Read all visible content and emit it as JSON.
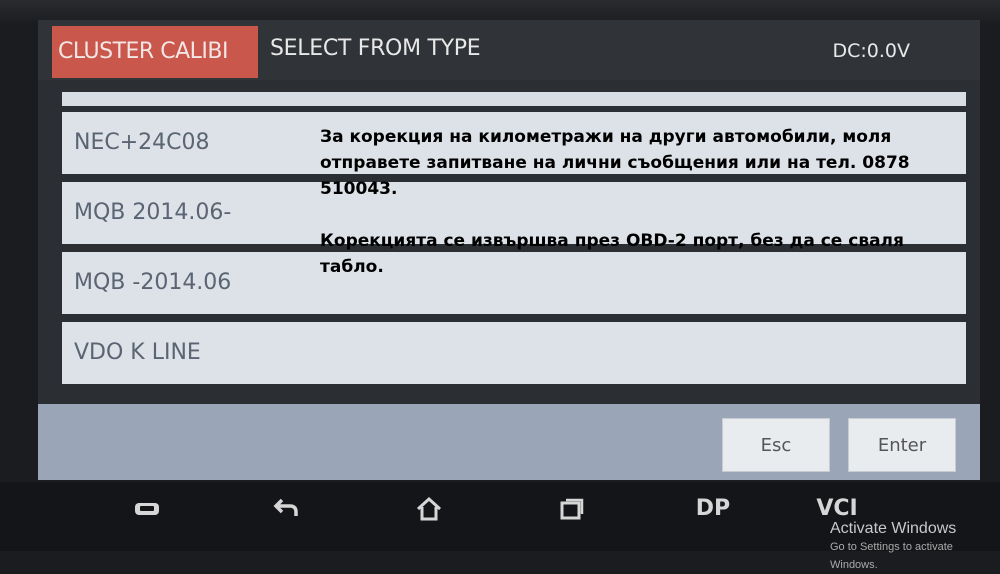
{
  "header": {
    "tab_label": "CLUSTER CALIBI",
    "title": "SELECT FROM TYPE",
    "voltage": "DC:0.0V"
  },
  "list": {
    "items": [
      {
        "label": "NEC+24C08"
      },
      {
        "label": "MQB 2014.06-"
      },
      {
        "label": "MQB -2014.06"
      },
      {
        "label": "VDO K LINE"
      }
    ]
  },
  "buttons": {
    "esc": "Esc",
    "enter": "Enter"
  },
  "nav": {
    "dp": "DP",
    "vci": "VCI",
    "icons": [
      "car-icon",
      "back-icon",
      "home-icon",
      "recent-apps-icon"
    ]
  },
  "overlay": {
    "line1": "За корекция на километражи на други автомобили, моля отправете запитване на лични съобщения или на тел. 0878 510043.",
    "line2": "Корекцията се извършва през OBD-2 порт, без да се сваля табло."
  },
  "watermark": {
    "title": "Activate Windows",
    "subtitle": "Go to Settings to activate Windows."
  },
  "colors": {
    "accent": "#c9574c",
    "footer": "#9aa6b8",
    "list_bg": "#dde2e8"
  }
}
